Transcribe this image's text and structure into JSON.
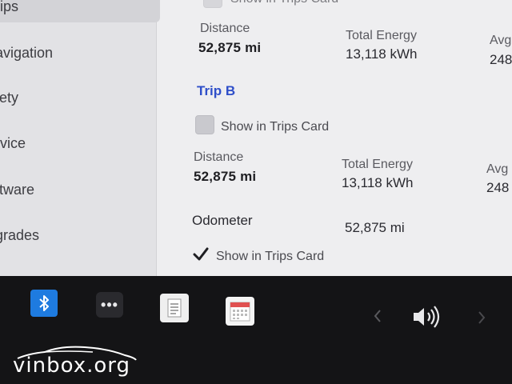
{
  "sidebar": {
    "items": [
      {
        "label": "rips"
      },
      {
        "label": "avigation"
      },
      {
        "label": "fety"
      },
      {
        "label": "rvice"
      },
      {
        "label": "ftware"
      },
      {
        "label": "grades"
      }
    ]
  },
  "trip_a": {
    "show_in_trips_card": "Show in Trips Card",
    "distance_label": "Distance",
    "distance_value": "52,875 mi",
    "energy_label": "Total Energy",
    "energy_value": "13,118 kWh",
    "avg_label": "Avg",
    "avg_value": "248"
  },
  "trip_b": {
    "title": "Trip B",
    "show_in_trips_card": "Show in Trips Card",
    "show_checked": false,
    "distance_label": "Distance",
    "distance_value": "52,875 mi",
    "energy_label": "Total Energy",
    "energy_value": "13,118 kWh",
    "avg_label": "Avg",
    "avg_value": "248"
  },
  "odometer": {
    "label": "Odometer",
    "value": "52,875 mi",
    "show_in_trips_card": "Show in Trips Card",
    "show_checked": true
  },
  "taskbar": {
    "apps_label": "•••",
    "icons": [
      "bluetooth-icon",
      "apps-icon",
      "notepad-icon",
      "calendar-icon",
      "chevron-left-icon",
      "volume-icon",
      "chevron-right-icon"
    ]
  },
  "watermark": {
    "text": "vinbox.org"
  },
  "colors": {
    "accent": "#2f4fc9",
    "bluetooth": "#1e7be0",
    "screen_bg": "#eeeef0",
    "sidebar_bg": "#e2e2e5"
  }
}
